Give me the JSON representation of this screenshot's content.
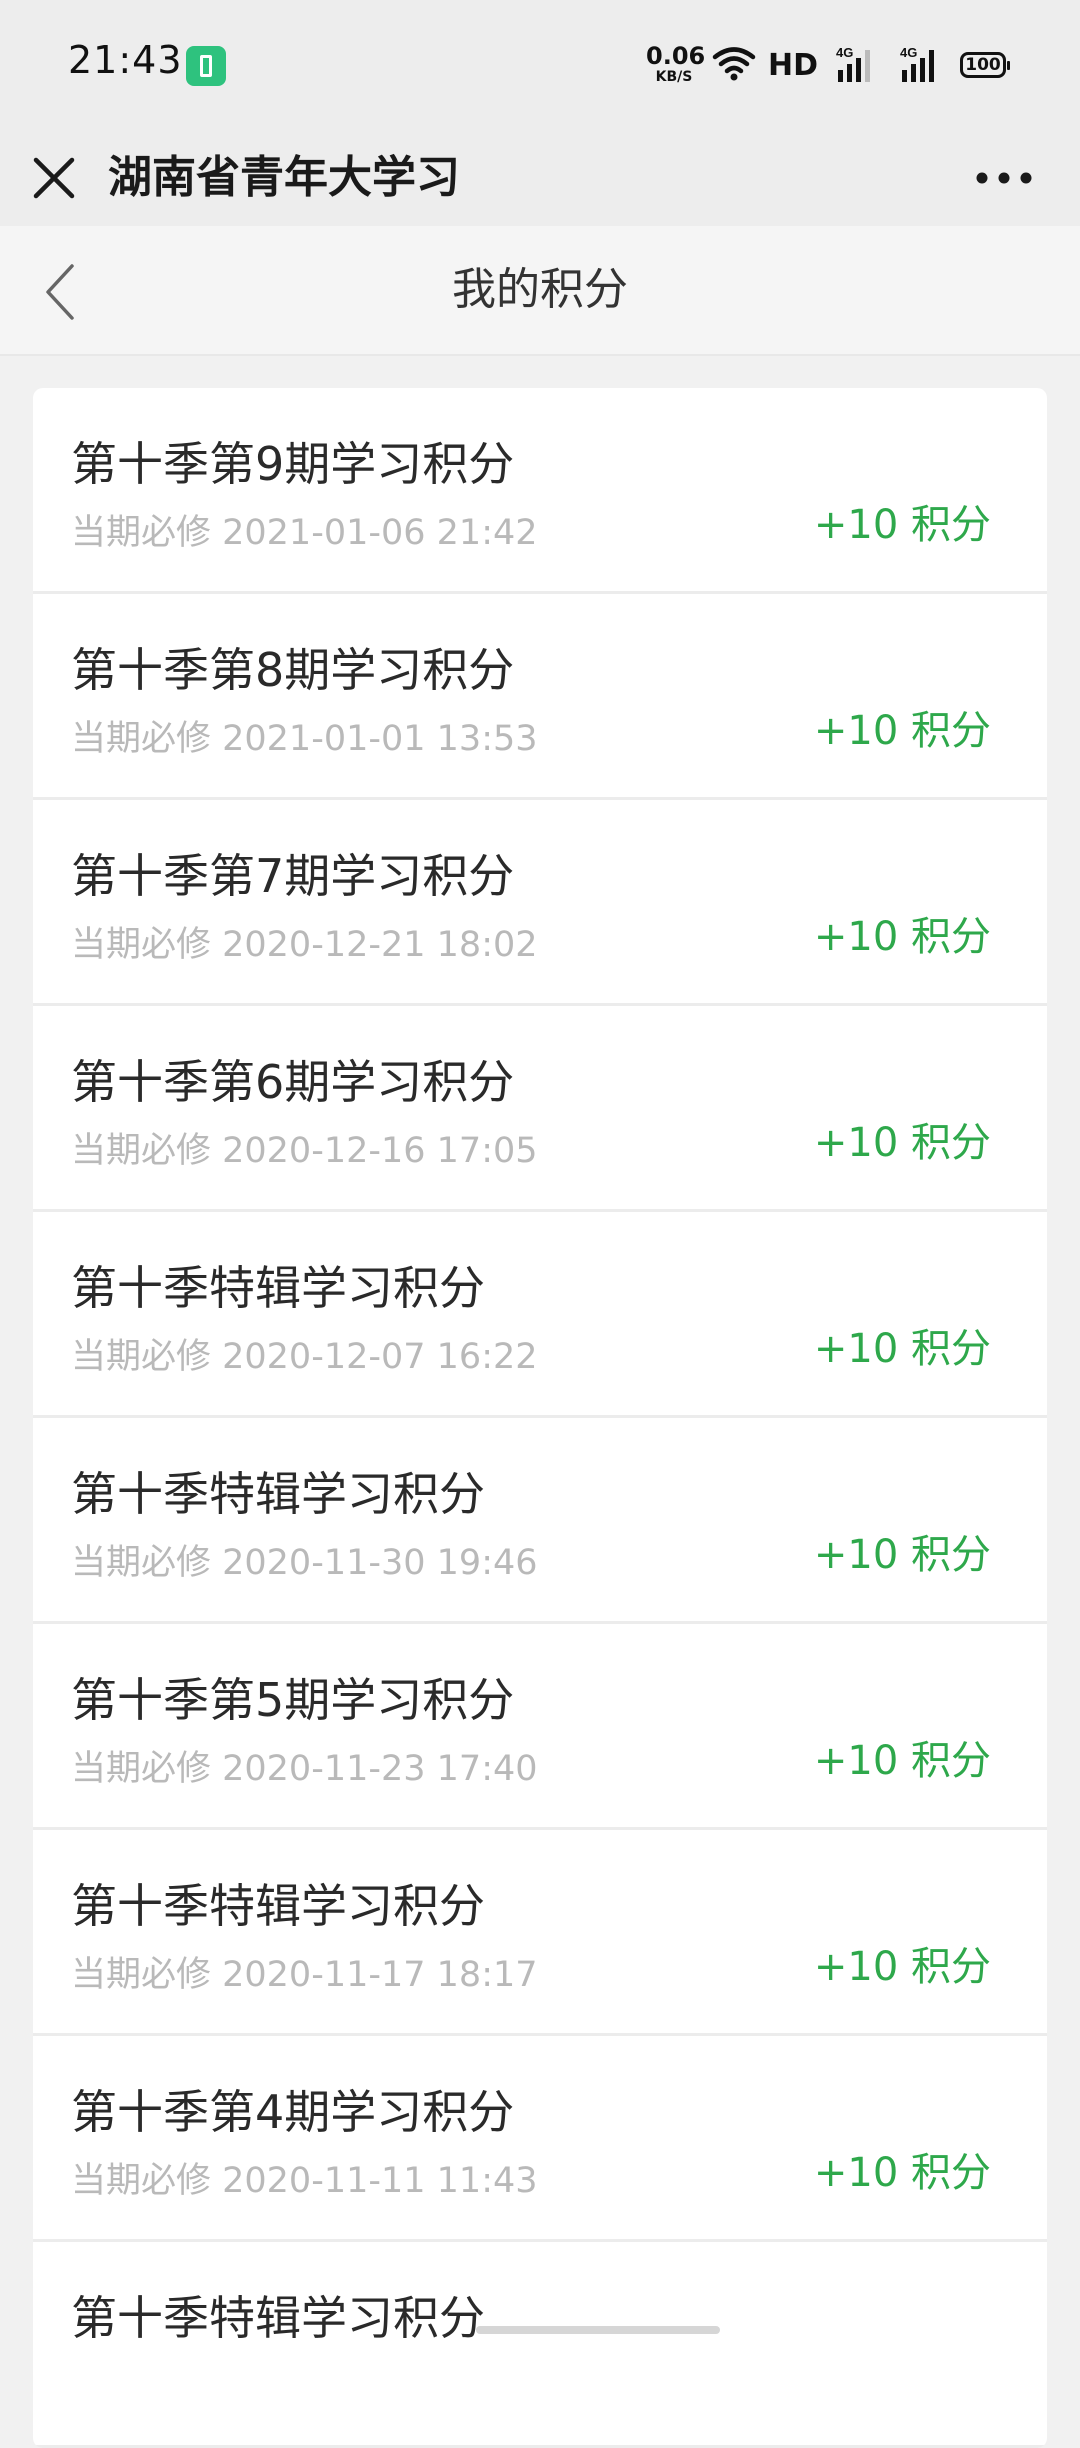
{
  "status_bar": {
    "time": "21:43",
    "net_speed_value": "0.06",
    "net_speed_unit": "KB/S",
    "hd_label": "HD",
    "battery_level": "100"
  },
  "header": {
    "title": "湖南省青年大学习"
  },
  "page": {
    "title": "我的积分"
  },
  "items": [
    {
      "title": "第十季第9期学习积分",
      "subtitle": "当期必修 2021-01-06 21:42",
      "points": "+10 积分"
    },
    {
      "title": "第十季第8期学习积分",
      "subtitle": "当期必修 2021-01-01 13:53",
      "points": "+10 积分"
    },
    {
      "title": "第十季第7期学习积分",
      "subtitle": "当期必修 2020-12-21 18:02",
      "points": "+10 积分"
    },
    {
      "title": "第十季第6期学习积分",
      "subtitle": "当期必修 2020-12-16 17:05",
      "points": "+10 积分"
    },
    {
      "title": "第十季特辑学习积分",
      "subtitle": "当期必修 2020-12-07 16:22",
      "points": "+10 积分"
    },
    {
      "title": "第十季特辑学习积分",
      "subtitle": "当期必修 2020-11-30 19:46",
      "points": "+10 积分"
    },
    {
      "title": "第十季第5期学习积分",
      "subtitle": "当期必修 2020-11-23 17:40",
      "points": "+10 积分"
    },
    {
      "title": "第十季特辑学习积分",
      "subtitle": "当期必修 2020-11-17 18:17",
      "points": "+10 积分"
    },
    {
      "title": "第十季第4期学习积分",
      "subtitle": "当期必修 2020-11-11 11:43",
      "points": "+10 积分"
    },
    {
      "title": "第十季特辑学习积分",
      "subtitle": "",
      "points": ""
    }
  ],
  "colors": {
    "points_green": "#2ea84b",
    "battery_saver_green": "#2ec27e",
    "background": "#f1f1f1"
  },
  "icons": {
    "battery_saver": "battery-saver-icon",
    "wifi": "wifi-icon",
    "signal_1": "signal-icon",
    "signal_2": "signal-icon",
    "battery": "battery-icon",
    "close": "close-icon",
    "more": "more-icon",
    "back": "back-icon"
  }
}
